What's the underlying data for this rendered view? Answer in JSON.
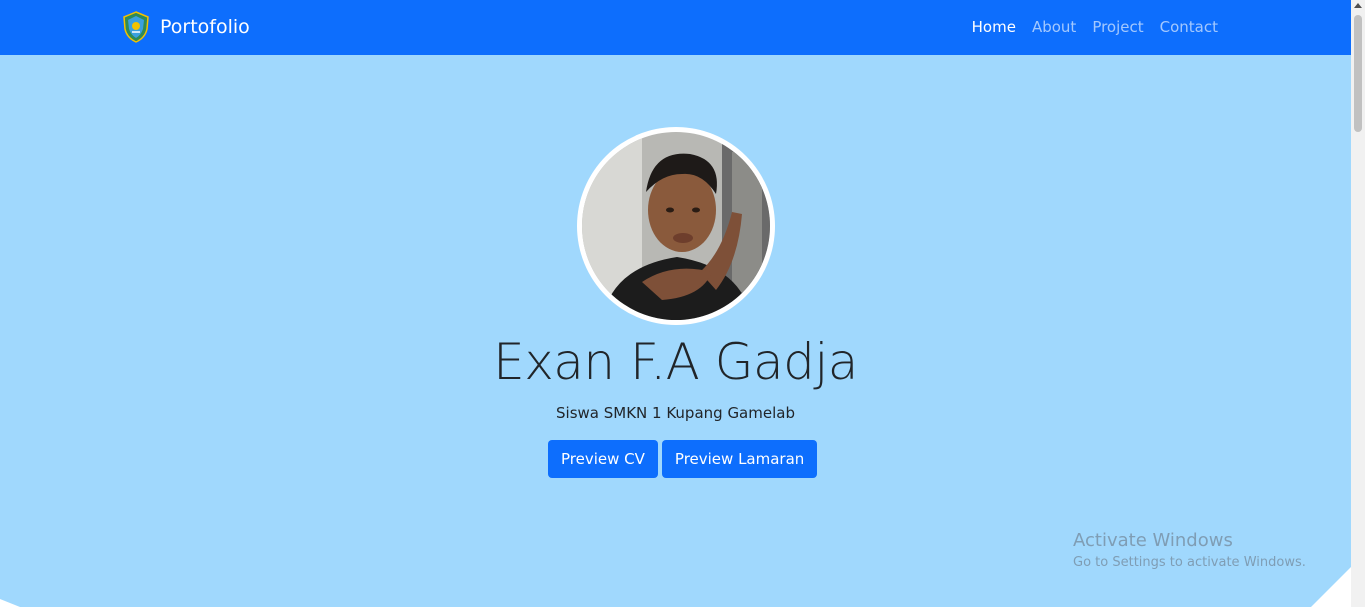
{
  "navbar": {
    "brand": "Portofolio",
    "links": [
      {
        "label": "Home",
        "active": true
      },
      {
        "label": "About",
        "active": false
      },
      {
        "label": "Project",
        "active": false
      },
      {
        "label": "Contact",
        "active": false
      }
    ]
  },
  "hero": {
    "name": "Exan F.A Gadja",
    "subtitle": "Siswa SMKN 1 Kupang Gamelab",
    "buttons": {
      "cv": "Preview CV",
      "lamaran": "Preview Lamaran"
    }
  },
  "watermark": {
    "title": "Activate Windows",
    "subtitle": "Go to Settings to activate Windows."
  },
  "colors": {
    "navbar": "#0d6efd",
    "background": "#a0d8fd",
    "button": "#0d6efd"
  }
}
